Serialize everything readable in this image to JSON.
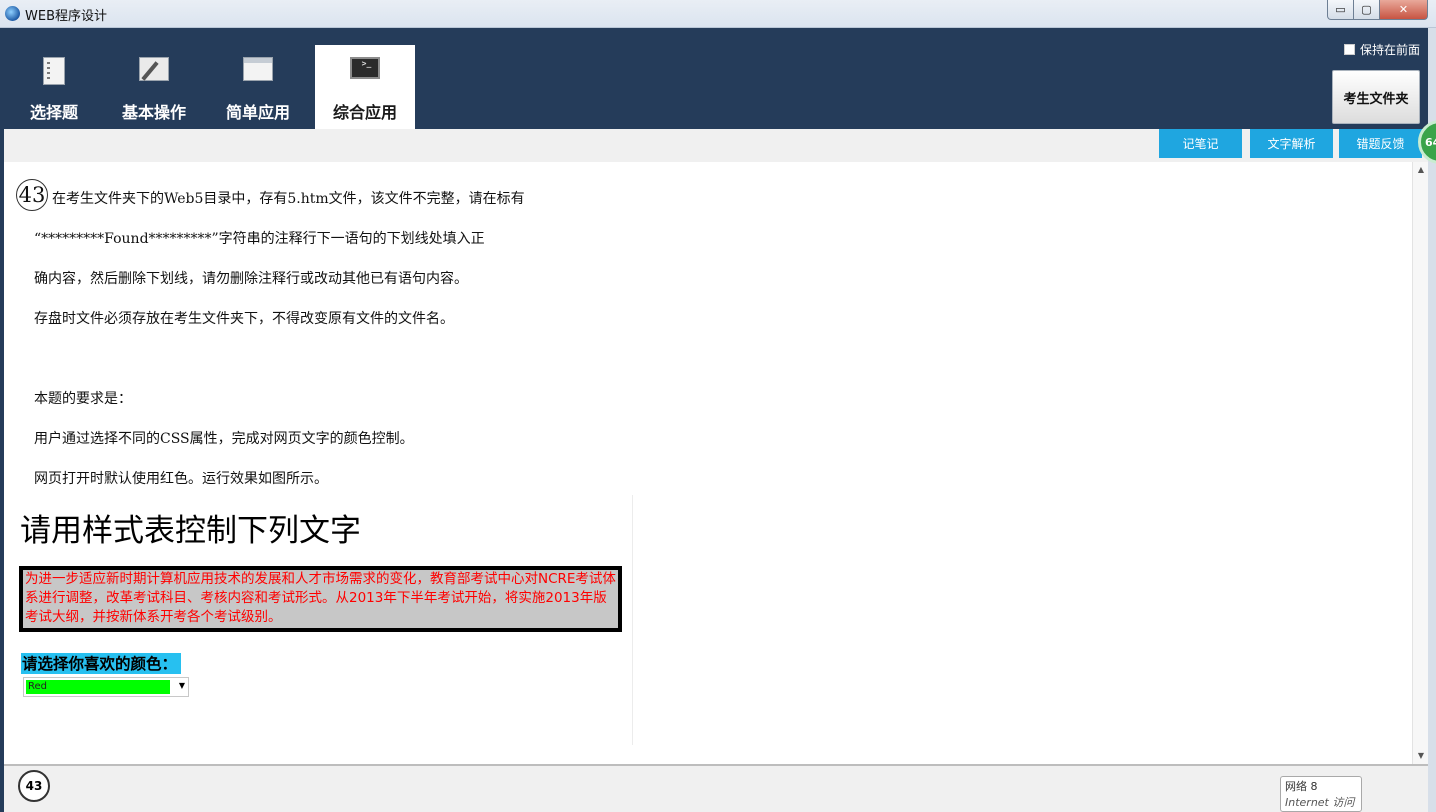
{
  "window": {
    "title": "WEB程序设计",
    "minimize": "▭",
    "maximize": "▢",
    "close": "✕"
  },
  "tabs": [
    {
      "label": "选择题",
      "icon": "document-icon",
      "active": false
    },
    {
      "label": "基本操作",
      "icon": "edit-icon",
      "active": false
    },
    {
      "label": "简单应用",
      "icon": "window-icon",
      "active": false
    },
    {
      "label": "综合应用",
      "icon": "terminal-icon",
      "active": true
    }
  ],
  "header": {
    "keep_front_label": "保持在前面",
    "keep_front_checked": false,
    "exam_folder_button": "考生文件夹"
  },
  "toolbar": {
    "notes_button": "记笔记",
    "text_analysis_button": "文字解析",
    "error_feedback_button": "错题反馈",
    "badge": "64"
  },
  "question": {
    "number": "43",
    "lines": [
      "在考生文件夹下的Web5目录中，存有5.htm文件，该文件不完整，请在标有",
      "“*********Found*********”字符串的注释行下一语句的下划线处填入正",
      "确内容，然后删除下划线，请勿删除注释行或改动其他已有语句内容。",
      "存盘时文件必须存放在考生文件夹下，不得改变原有文件的文件名。",
      "本题的要求是：",
      "用户通过选择不同的CSS属性，完成对网页文字的颜色控制。",
      "网页打开时默认使用红色。运行效果如图所示。"
    ]
  },
  "preview": {
    "heading": "请用样式表控制下列文字",
    "paragraph": "为进一步适应新时期计算机应用技术的发展和人才市场需求的变化，教育部考试中心对NCRE考试体系进行调整，改革考试科目、考核内容和考试形式。从2013年下半年考试开始，将实施2013年版考试大纲，并按新体系开考各个考试级别。",
    "prompt_label": "请选择你喜欢的颜色：",
    "select_value": "Red",
    "text_color": "#ff0000",
    "box_background": "#c7c7c7",
    "label_background": "#27c0f0",
    "select_background": "#00ff00"
  },
  "bottom": {
    "question_number": "43",
    "tooltip_line1": "网络 8",
    "tooltip_line2": "Internet 访问"
  },
  "colors": {
    "header_bg": "#253c5a",
    "accent_button": "#1fa6e0"
  }
}
